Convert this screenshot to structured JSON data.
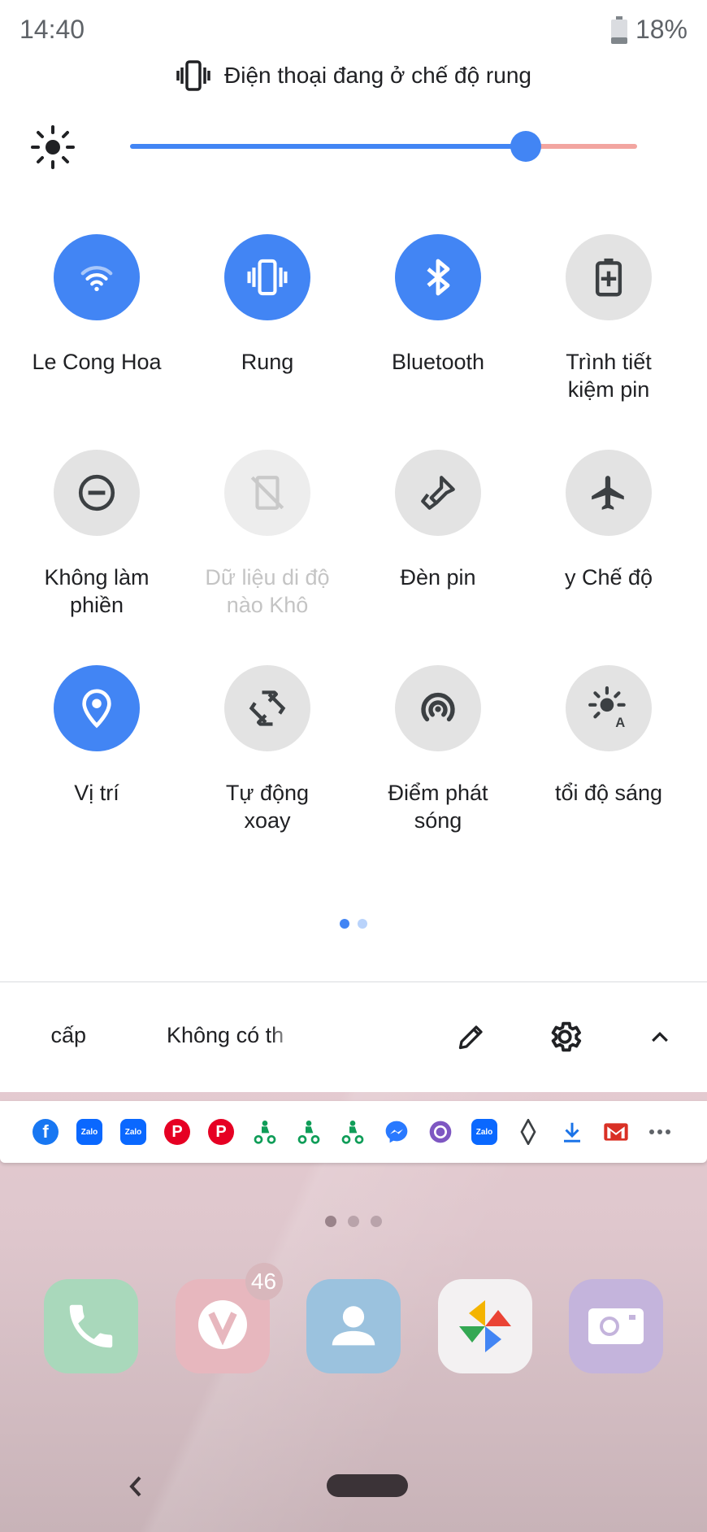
{
  "status": {
    "time": "14:40",
    "battery_pct": "18%"
  },
  "vibrate_notice": "Điện thoại đang ở chế độ rung",
  "brightness": {
    "level": 0.78
  },
  "tiles": [
    {
      "label": "Le Cong Hoa",
      "state": "on",
      "icon": "wifi-icon"
    },
    {
      "label": "Rung",
      "state": "on",
      "icon": "vibrate-icon"
    },
    {
      "label": "Bluetooth",
      "state": "on",
      "icon": "bluetooth-icon"
    },
    {
      "label": "Trình tiết\nkiệm pin",
      "state": "off",
      "icon": "battery-saver-icon"
    },
    {
      "label": "Không làm\nphiền",
      "state": "off",
      "icon": "do-not-disturb-icon"
    },
    {
      "label": "Dữ liệu di độ",
      "label2": "nào      Khô",
      "state": "unavailable",
      "icon": "mobile-data-off-icon"
    },
    {
      "label": "Đèn pin",
      "state": "off",
      "icon": "flashlight-icon"
    },
    {
      "label": "y      Chế độ",
      "state": "off",
      "icon": "airplane-icon"
    },
    {
      "label": "Vị trí",
      "state": "on",
      "icon": "location-icon"
    },
    {
      "label": "Tự động\nxoay",
      "state": "off",
      "icon": "auto-rotate-icon"
    },
    {
      "label": "Điểm phát\nsóng",
      "state": "off",
      "icon": "hotspot-icon"
    },
    {
      "label": "tổi độ sáng",
      "state": "off",
      "icon": "adaptive-brightness-icon"
    }
  ],
  "footer": {
    "left_text": "cấp",
    "message": "Không có th"
  },
  "notification_icons": [
    "facebook-icon",
    "zalo-icon",
    "zalo-icon",
    "pinterest-icon",
    "pinterest-icon",
    "delivery-icon",
    "delivery-icon",
    "delivery-icon",
    "messenger-icon",
    "aperture-icon",
    "zalo-icon",
    "diamond-icon",
    "download-icon",
    "gmail-icon",
    "more-icon"
  ],
  "notification_icon_labels": {
    "zalo": "Zalo"
  },
  "dock": {
    "vivo_badge": "46"
  },
  "colors": {
    "accent": "#4285f4",
    "tile_off": "#e3e3e3"
  }
}
